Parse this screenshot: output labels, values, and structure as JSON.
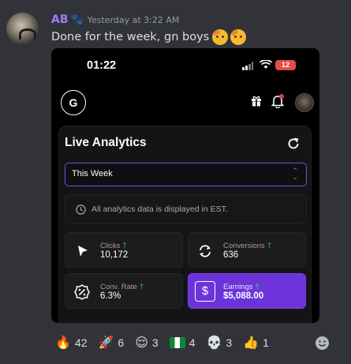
{
  "message": {
    "username": "AB",
    "timestamp": "Yesterday at 3:22 AM",
    "text": "Done for the week, gn boys"
  },
  "phone": {
    "time": "01:22",
    "battery": "12",
    "card": {
      "title": "Live Analytics",
      "select_value": "This Week",
      "notice": "All analytics data is displayed in EST.",
      "stats": [
        {
          "label": "Clicks",
          "value": "10,172",
          "icon": "cursor-icon"
        },
        {
          "label": "Conversions",
          "value": "636",
          "icon": "cycle-icon"
        },
        {
          "label": "Conv. Rate",
          "value": "6.3%",
          "icon": "percent-icon"
        },
        {
          "label": "Earnings",
          "value": "$5,088.00",
          "icon": "dollar-icon"
        }
      ]
    }
  },
  "reactions": [
    {
      "emoji": "fire",
      "glyph": "🔥",
      "count": "42"
    },
    {
      "emoji": "rocket",
      "glyph": "🚀",
      "count": "6"
    },
    {
      "emoji": "relieved",
      "glyph": "😌",
      "count": "3"
    },
    {
      "emoji": "nigeria-flag",
      "glyph": "",
      "count": "4"
    },
    {
      "emoji": "skull",
      "glyph": "💀",
      "count": "3"
    },
    {
      "emoji": "thumbs-up",
      "glyph": "👍",
      "count": "1"
    }
  ],
  "colors": {
    "background": "#323339",
    "username": "#a27cf4",
    "accent_purple": "#6c33d9",
    "up_green": "#2fcf6b"
  }
}
